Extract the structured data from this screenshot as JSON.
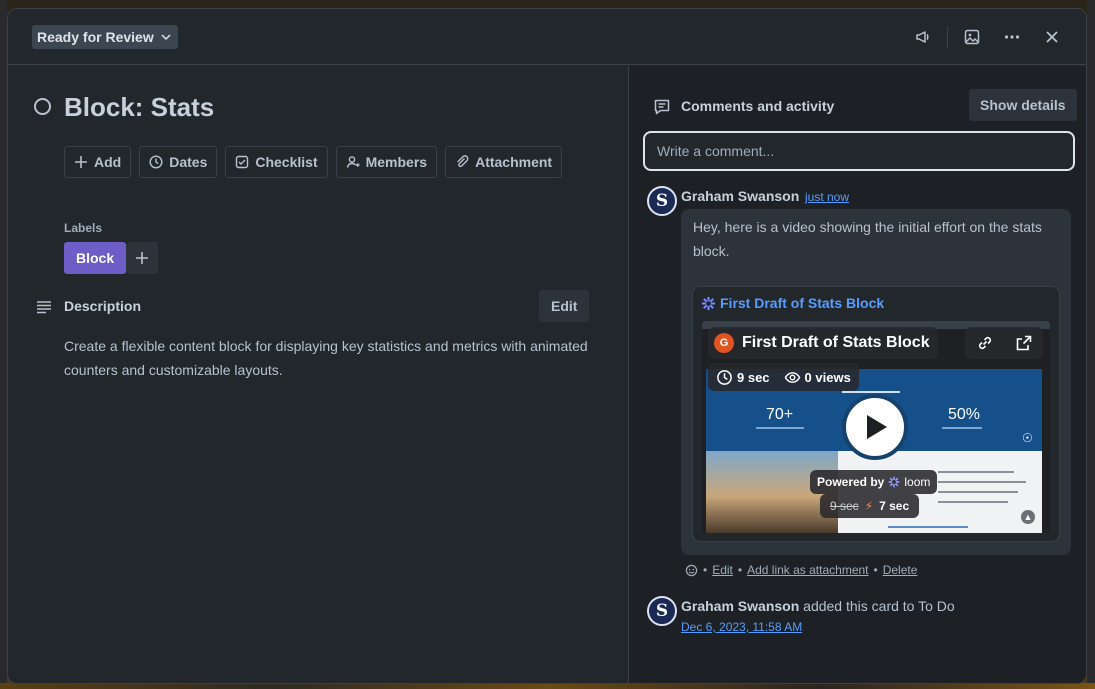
{
  "header": {
    "status": "Ready for Review",
    "icons": [
      "megaphone-icon",
      "image-icon",
      "more-icon",
      "close-icon"
    ]
  },
  "card": {
    "title": "Block: Stats",
    "actions": [
      {
        "label": "Add",
        "icon": "plus-icon"
      },
      {
        "label": "Dates",
        "icon": "clock-icon"
      },
      {
        "label": "Checklist",
        "icon": "checklist-icon"
      },
      {
        "label": "Members",
        "icon": "members-icon"
      },
      {
        "label": "Attachment",
        "icon": "paperclip-icon"
      }
    ],
    "labels_heading": "Labels",
    "labels": [
      {
        "name": "Block",
        "color": "#6e5dc6"
      }
    ],
    "description_heading": "Description",
    "description_edit": "Edit",
    "description": "Create a flexible content block for displaying key statistics and metrics with animated counters and customizable layouts."
  },
  "activity": {
    "heading": "Comments and activity",
    "show_details": "Show details",
    "comment_placeholder": "Write a comment...",
    "comment": {
      "avatar_letter": "S",
      "author": "Graham Swanson",
      "time": "just now",
      "text": "Hey, here is a video showing the initial effort on the stats block.",
      "embed": {
        "title": "First Draft of Stats Block",
        "video": {
          "badge": "G",
          "title": "First Draft of Stats Block",
          "duration": "9 sec",
          "views": "0 views",
          "stat_left": "70+",
          "stat_right": "50%",
          "powered_by": "Powered by",
          "brand": "loom",
          "original_time": "9 sec",
          "fast_time": "7 sec"
        }
      },
      "actions": [
        "Edit",
        "Add link as attachment",
        "Delete"
      ]
    },
    "event": {
      "avatar_letter": "S",
      "author": "Graham Swanson",
      "text": "added this card to To Do",
      "time": "Dec 6, 2023, 11:58 AM"
    }
  },
  "colors": {
    "modal_bg": "#22272b",
    "panel_bg": "#1d2125",
    "link": "#579dff",
    "label_purple": "#6e5dc6"
  }
}
